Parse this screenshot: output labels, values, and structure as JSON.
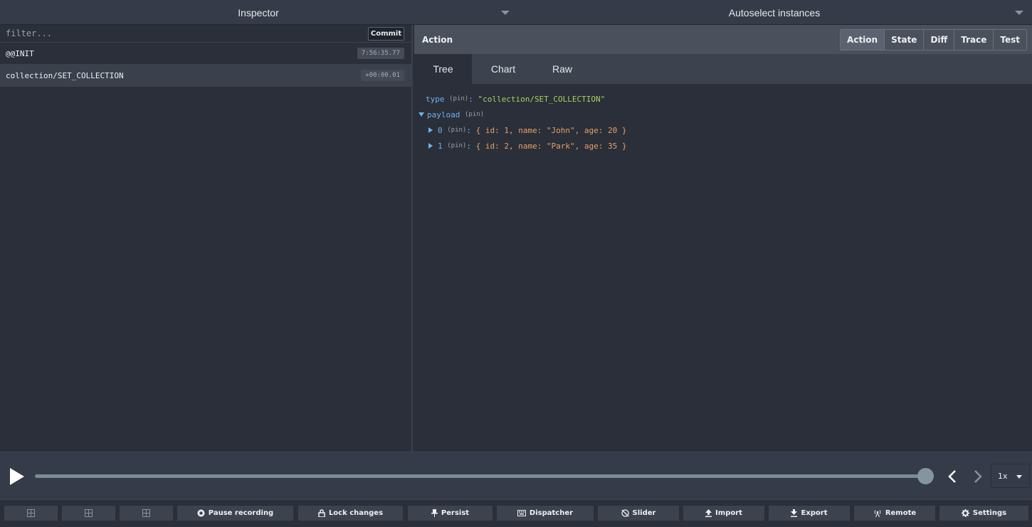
{
  "topbar": {
    "left_label": "Inspector",
    "right_label": "Autoselect instances"
  },
  "filter": {
    "placeholder": "filter...",
    "value": ""
  },
  "commit_label": "Commit",
  "actions": [
    {
      "name": "@@INIT",
      "time": "7:56:35.77"
    },
    {
      "name": "collection/SET_COLLECTION",
      "time": "+00:00.01"
    }
  ],
  "right": {
    "title": "Action",
    "monitors": [
      "Action",
      "State",
      "Diff",
      "Trace",
      "Test"
    ],
    "active_monitor": "Action",
    "tabs": [
      "Tree",
      "Chart",
      "Raw"
    ],
    "active_tab": "Tree"
  },
  "tree": {
    "type_key": "type",
    "pin": "(pin)",
    "type_value": "\"collection/SET_COLLECTION\"",
    "payload_key": "payload",
    "items": [
      {
        "key": "0",
        "value": "{ id: 1, name: \"John\", age: 20 }"
      },
      {
        "key": "1",
        "value": "{ id: 2, name: \"Park\", age: 35 }"
      }
    ]
  },
  "slider": {
    "speed": "1x",
    "position_fraction": 1.0
  },
  "toolbar": {
    "pause_recording": "Pause recording",
    "lock_changes": "Lock changes",
    "persist": "Persist",
    "dispatcher": "Dispatcher",
    "slider": "Slider",
    "import": "Import",
    "export": "Export",
    "remote": "Remote",
    "settings": "Settings"
  }
}
